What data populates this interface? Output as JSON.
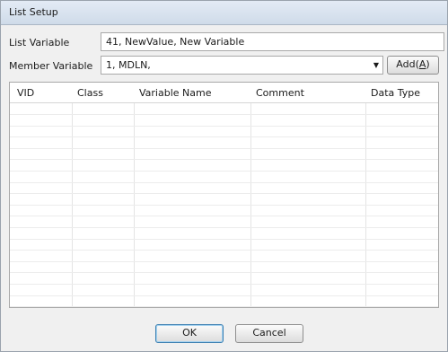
{
  "window": {
    "title": "List Setup"
  },
  "list_variable": {
    "label": "List Variable",
    "value": "41, NewValue, New Variable"
  },
  "member_variable": {
    "label": "Member Variable",
    "selected": "1, MDLN,",
    "add_button": {
      "text_before": "Add(",
      "mnemonic": "A",
      "text_after": ")"
    }
  },
  "table": {
    "columns": [
      "VID",
      "Class",
      "Variable Name",
      "Comment",
      "Data Type"
    ],
    "rows": []
  },
  "buttons": {
    "ok": "OK",
    "cancel": "Cancel"
  },
  "icons": {
    "dropdown": "chevron-down-icon"
  }
}
